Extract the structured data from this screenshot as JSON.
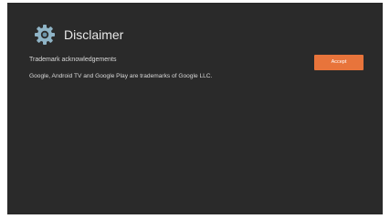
{
  "header": {
    "icon": "gear-icon",
    "title": "Disclaimer"
  },
  "content": {
    "subtitle": "Trademark acknowledgements",
    "body": "Google, Android TV and Google Play are trademarks of Google LLC."
  },
  "actions": {
    "accept_label": "Accept"
  },
  "colors": {
    "background": "#2a2a2a",
    "accent": "#e8743b",
    "icon": "#8fb4c6"
  }
}
